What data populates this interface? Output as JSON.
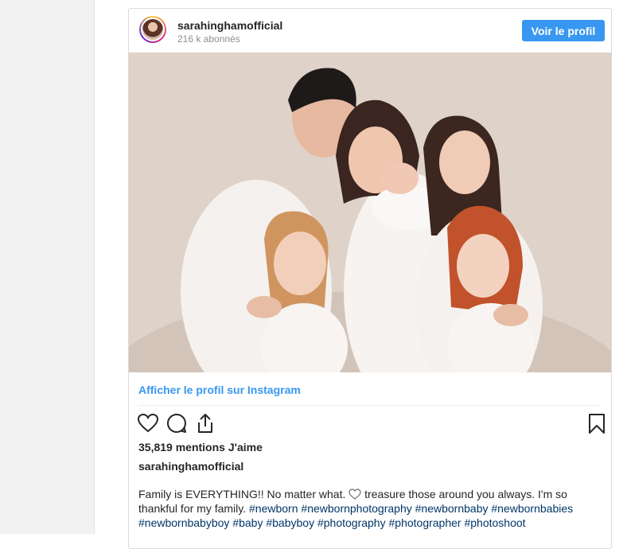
{
  "header": {
    "username": "sarahinghamofficial",
    "followers": "216 k abonnés",
    "view_profile_button": "Voir le profil"
  },
  "post": {
    "view_on_instagram": "Afficher le profil sur Instagram",
    "likes": "35,819 mentions J'aime",
    "caption_user": "sarahinghamofficial",
    "caption_text_1": "Family is EVERYTHING!! No matter what. ",
    "caption_text_2": " treasure those around you always. I'm so thankful for my family. ",
    "hashtags": [
      "#newborn",
      "#newbornphotography",
      "#newbornbaby",
      "#newbornbabies",
      "#newbornbabyboy",
      "#baby",
      "#babyboy",
      "#photography",
      "#photographer",
      "#photoshoot"
    ]
  },
  "icons": [
    "heart-icon",
    "comment-icon",
    "share-icon",
    "bookmark-icon",
    "heart-emoji-icon"
  ],
  "colors": {
    "accent": "#3897f0",
    "hashtag": "#003569",
    "muted": "#8e8e8e"
  }
}
